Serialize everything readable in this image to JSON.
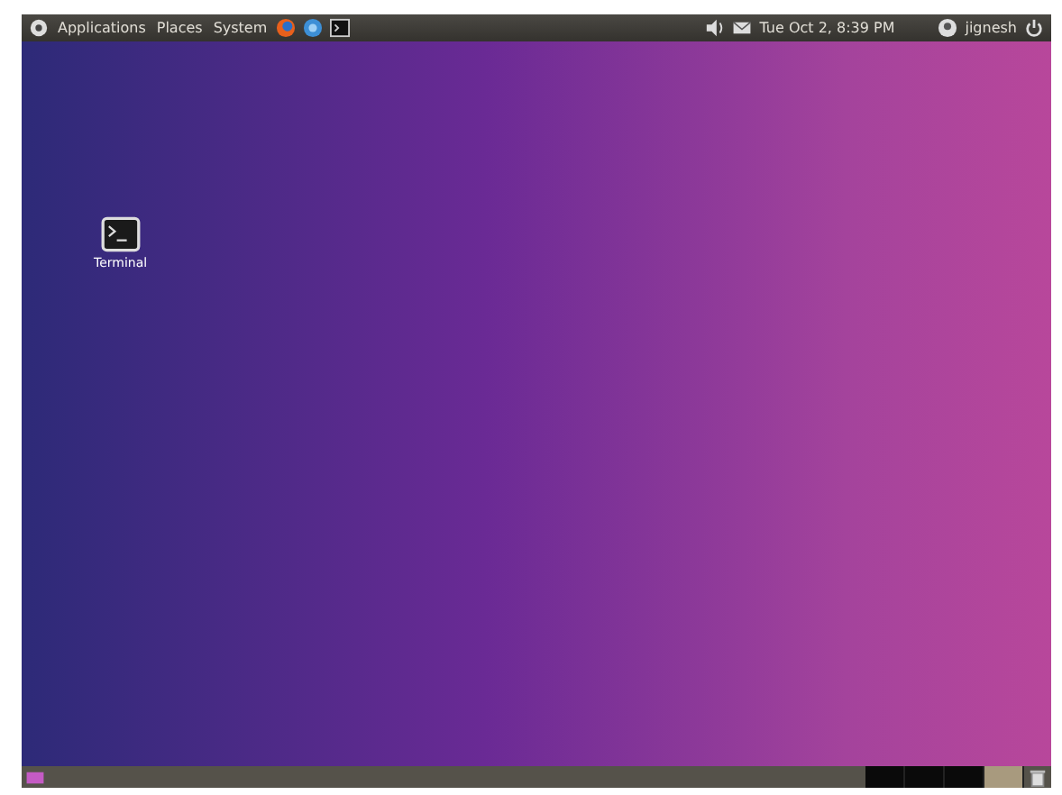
{
  "top_panel": {
    "menus": [
      "Applications",
      "Places",
      "System"
    ],
    "clock": "Tue Oct 2, 8:39 PM",
    "user": "jignesh"
  },
  "desktop": {
    "icons": [
      {
        "label": "Terminal"
      }
    ]
  },
  "bottom_panel": {
    "workspaces": [
      {
        "selected": false
      },
      {
        "selected": false
      },
      {
        "selected": false
      },
      {
        "selected": true
      }
    ]
  }
}
